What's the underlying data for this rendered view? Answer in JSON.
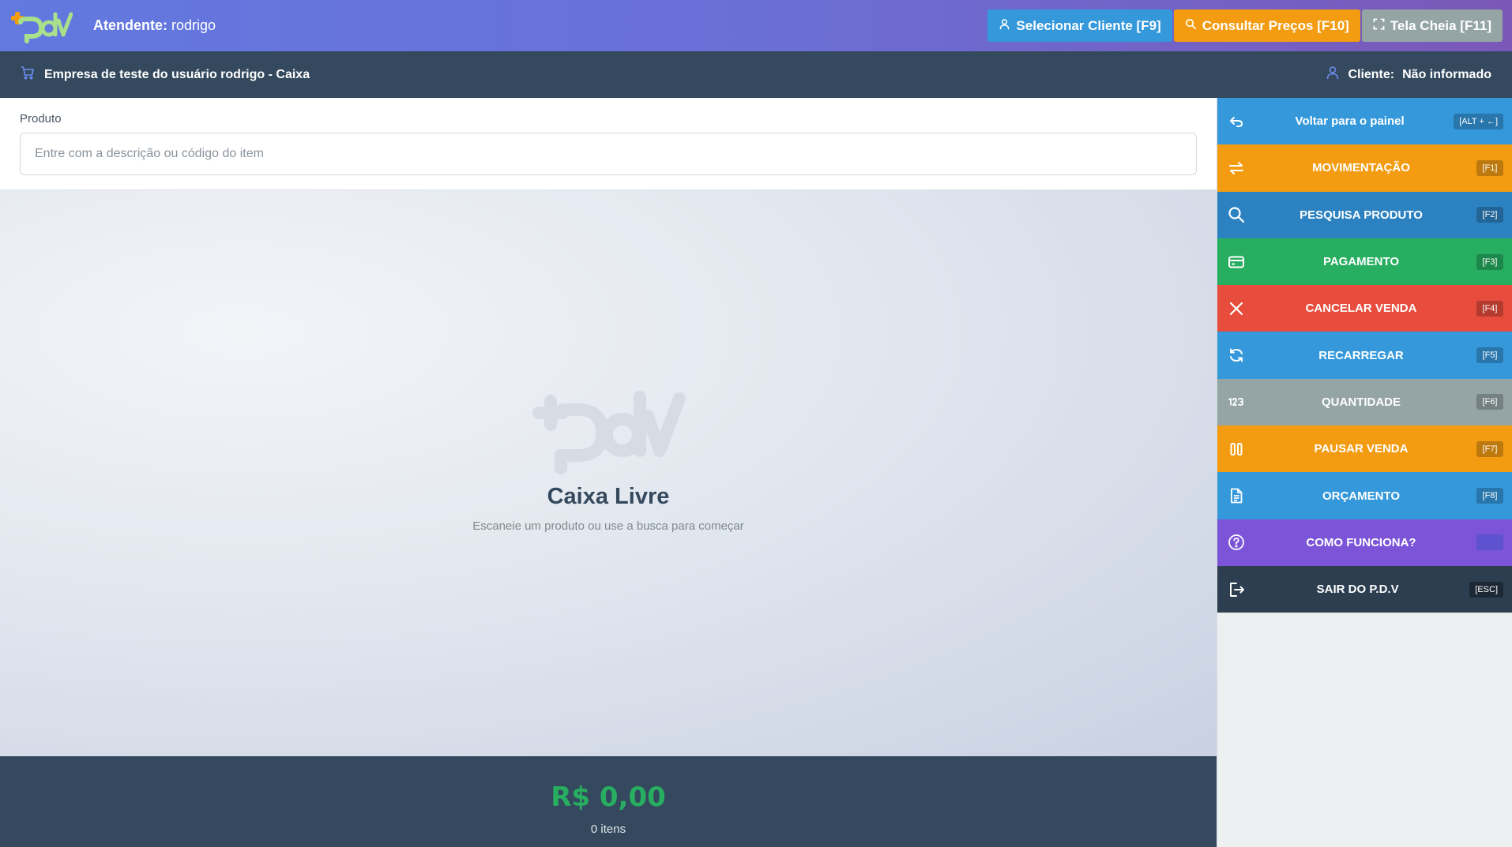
{
  "header": {
    "attendant_label": "Atendente:",
    "attendant_name": "rodrigo",
    "buttons": [
      {
        "label": "Selecionar Cliente [F9]",
        "icon": "user-icon",
        "color": "#3498db"
      },
      {
        "label": "Consultar Preços [F10]",
        "icon": "search-icon",
        "color": "#f39c12"
      },
      {
        "label": "Tela Cheia [F11]",
        "icon": "fullscreen-icon",
        "color": "#95a5a6"
      }
    ]
  },
  "infobar": {
    "company": "Empresa de teste do usuário rodrigo - Caixa",
    "client_label": "Cliente:",
    "client_value": "Não informado"
  },
  "product": {
    "label": "Produto",
    "placeholder": "Entre com a descrição ou código do item",
    "value": ""
  },
  "empty_state": {
    "title": "Caixa Livre",
    "subtitle": "Escaneie um produto ou use a busca para começar"
  },
  "totals": {
    "value": "R$ 0,00",
    "items": "0 itens"
  },
  "sidebar": {
    "items": [
      {
        "label": "Voltar para o painel",
        "shortcut": "[ALT + ←]",
        "icon": "return-arrow-icon",
        "color": "#3498db"
      },
      {
        "label": "MOVIMENTAÇÃO",
        "shortcut": "[F1]",
        "icon": "transfer-arrows-icon",
        "color": "#f39c12"
      },
      {
        "label": "PESQUISA PRODUTO",
        "shortcut": "[F2]",
        "icon": "search-icon",
        "color": "#2c82c0"
      },
      {
        "label": "PAGAMENTO",
        "shortcut": "[F3]",
        "icon": "credit-card-icon",
        "color": "#27ae60"
      },
      {
        "label": "CANCELAR VENDA",
        "shortcut": "[F4]",
        "icon": "close-icon",
        "color": "#e74c3c"
      },
      {
        "label": "RECARREGAR",
        "shortcut": "[F5]",
        "icon": "refresh-icon",
        "color": "#3498db"
      },
      {
        "label": "QUANTIDADE",
        "shortcut": "[F6]",
        "icon": "numbers-123-icon",
        "color": "#95a5a6"
      },
      {
        "label": "PAUSAR VENDA",
        "shortcut": "[F7]",
        "icon": "pause-icon",
        "color": "#f39c12"
      },
      {
        "label": "ORÇAMENTO",
        "shortcut": "[F8]",
        "icon": "document-icon",
        "color": "#3498db"
      },
      {
        "label": "COMO FUNCIONA?",
        "shortcut": "",
        "icon": "help-circle-icon",
        "color": "#7b54d8"
      },
      {
        "label": "SAIR DO P.D.V",
        "shortcut": "[ESC]",
        "icon": "logout-icon",
        "color": "#2c3e50"
      }
    ]
  }
}
